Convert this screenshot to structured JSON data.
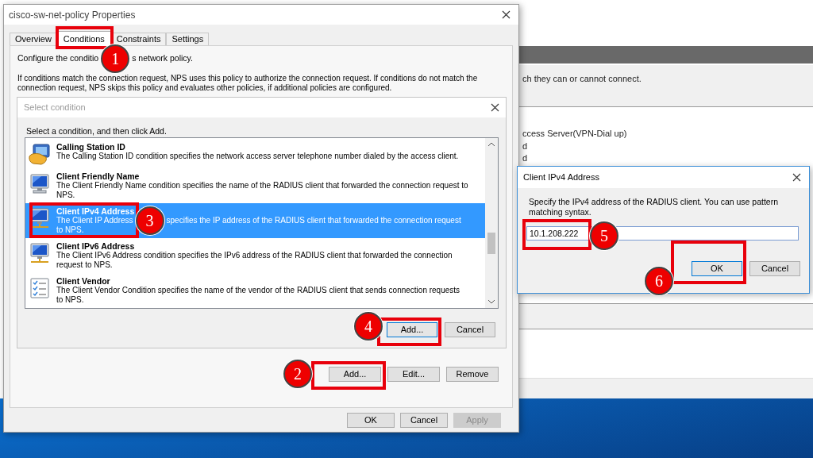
{
  "background_window": {
    "fragments": [
      "ch they can or cannot connect.",
      "ccess Server(VPN-Dial up)",
      "d",
      "d"
    ]
  },
  "properties_window": {
    "title": "cisco-sw-net-policy Properties",
    "tabs": [
      {
        "label": "Overview",
        "selected": false
      },
      {
        "label": "Conditions",
        "selected": true
      },
      {
        "label": "Constraints",
        "selected": false
      },
      {
        "label": "Settings",
        "selected": false
      }
    ],
    "intro": {
      "parts": [
        "Configure the conditio",
        "s network policy."
      ],
      "marker": "1"
    },
    "description": "If conditions match the connection request, NPS uses this policy to authorize the connection request. If conditions do not match the connection request, NPS skips this policy and evaluates other policies, if additional policies are configured.",
    "condition_buttons": [
      {
        "label": "Add..."
      },
      {
        "label": "Edit..."
      },
      {
        "label": "Remove"
      }
    ],
    "footer_buttons": [
      {
        "label": "OK",
        "disabled": false
      },
      {
        "label": "Cancel",
        "disabled": false
      },
      {
        "label": "Apply",
        "disabled": true
      }
    ]
  },
  "select_condition": {
    "title": "Select condition",
    "instruction": "Select a condition, and then click Add.",
    "items": [
      {
        "kind": "phone",
        "title": "Calling Station ID",
        "selected": false,
        "lines": [
          [
            "The Calling Station ID condition specifies the network access server telephone number dialed by the access client."
          ]
        ]
      },
      {
        "kind": "monitor",
        "title": "Client Friendly Name",
        "selected": false,
        "lines": [
          [
            "The Client Friendly Name condition specifies the name of the RADIUS client that forwarded the connection request to"
          ],
          [
            "NPS."
          ]
        ]
      },
      {
        "kind": "network",
        "title": "Client IPv4 Address",
        "selected": true,
        "marker": "3",
        "lines": [
          [
            "The Client IP Address",
            "specifies the IP address of the RADIUS client that forwarded the connection request"
          ],
          [
            "to NPS."
          ]
        ]
      },
      {
        "kind": "network",
        "title": "Client IPv6 Address",
        "selected": false,
        "lines": [
          [
            "The Client IPv6 Address condition specifies the IPv6 address of the RADIUS client that forwarded the connection"
          ],
          [
            "request to NPS."
          ]
        ]
      },
      {
        "kind": "checklist",
        "title": "Client Vendor",
        "selected": false,
        "lines": [
          [
            "The Client Vendor Condition specifies the name of the vendor of the RADIUS client that sends connection requests"
          ],
          [
            "to NPS."
          ]
        ]
      }
    ],
    "buttons": [
      {
        "label": "Add...",
        "focused": true
      },
      {
        "label": "Cancel",
        "focused": false
      }
    ]
  },
  "ipv4_dialog": {
    "title": "Client IPv4 Address",
    "prompt": "Specify the IPv4 address of the RADIUS client. You can use pattern matching syntax.",
    "value": "10.1.208.222",
    "buttons": [
      {
        "label": "OK",
        "focused": true
      },
      {
        "label": "Cancel",
        "focused": false
      }
    ]
  },
  "step_markers": [
    "2",
    "4",
    "5",
    "6"
  ]
}
